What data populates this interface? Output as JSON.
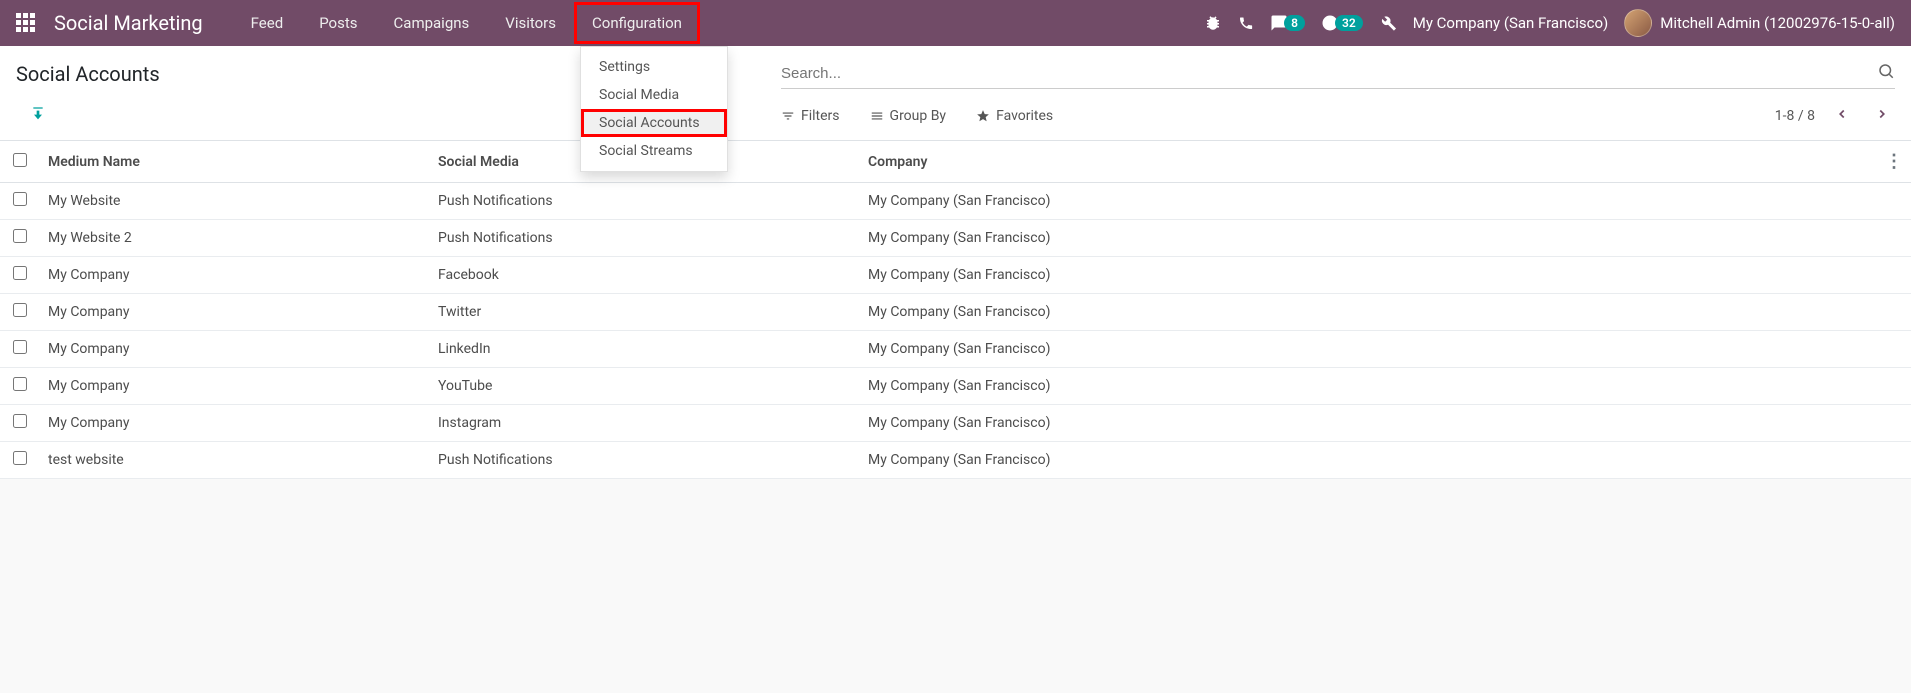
{
  "navbar": {
    "app_title": "Social Marketing",
    "menu": [
      "Feed",
      "Posts",
      "Campaigns",
      "Visitors",
      "Configuration"
    ],
    "highlighted_index": 4,
    "badges": {
      "messages": "8",
      "activities": "32"
    },
    "company": "My Company (San Francisco)",
    "user": "Mitchell Admin (12002976-15-0-all)"
  },
  "config_dropdown": {
    "items": [
      "Settings",
      "Social Media",
      "Social Accounts",
      "Social Streams"
    ],
    "highlighted_index": 2
  },
  "page": {
    "title": "Social Accounts",
    "search_placeholder": "Search...",
    "filters_label": "Filters",
    "groupby_label": "Group By",
    "favorites_label": "Favorites",
    "pager": "1-8 / 8"
  },
  "table": {
    "headers": {
      "medium": "Medium Name",
      "social": "Social Media",
      "company": "Company"
    },
    "rows": [
      {
        "medium": "My Website",
        "social": "Push Notifications",
        "company": "My Company (San Francisco)"
      },
      {
        "medium": "My Website 2",
        "social": "Push Notifications",
        "company": "My Company (San Francisco)"
      },
      {
        "medium": "My Company",
        "social": "Facebook",
        "company": "My Company (San Francisco)"
      },
      {
        "medium": "My Company",
        "social": "Twitter",
        "company": "My Company (San Francisco)"
      },
      {
        "medium": "My Company",
        "social": "LinkedIn",
        "company": "My Company (San Francisco)"
      },
      {
        "medium": "My Company",
        "social": "YouTube",
        "company": "My Company (San Francisco)"
      },
      {
        "medium": "My Company",
        "social": "Instagram",
        "company": "My Company (San Francisco)"
      },
      {
        "medium": "test website",
        "social": "Push Notifications",
        "company": "My Company (San Francisco)"
      }
    ]
  }
}
